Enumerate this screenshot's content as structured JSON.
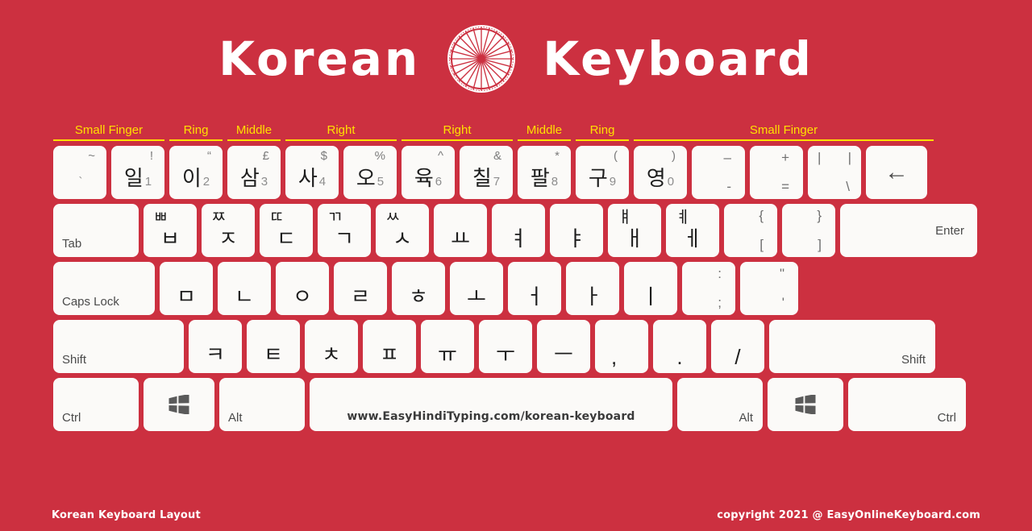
{
  "header": {
    "title_left": "Korean",
    "title_right": "Keyboard",
    "emblem_name": "korean-rosette-emblem"
  },
  "finger_guide": [
    {
      "label": "Small Finger",
      "span": 2
    },
    {
      "label": "Ring",
      "span": 1
    },
    {
      "label": "Middle",
      "span": 1
    },
    {
      "label": "Right",
      "span": 2
    },
    {
      "label": "Right",
      "span": 2
    },
    {
      "label": "Middle",
      "span": 1
    },
    {
      "label": "Ring",
      "span": 1
    },
    {
      "label": "Small Finger",
      "span": 5
    }
  ],
  "rows": {
    "number_row": [
      {
        "top": "~",
        "main": "",
        "digit": "`"
      },
      {
        "top": "!",
        "main": "일",
        "digit": "1"
      },
      {
        "top": "“",
        "main": "이",
        "digit": "2"
      },
      {
        "top": "£",
        "main": "삼",
        "digit": "3"
      },
      {
        "top": "$",
        "main": "사",
        "digit": "4"
      },
      {
        "top": "%",
        "main": "오",
        "digit": "5"
      },
      {
        "top": "^",
        "main": "육",
        "digit": "6"
      },
      {
        "top": "&",
        "main": "칠",
        "digit": "7"
      },
      {
        "top": "*",
        "main": "팔",
        "digit": "8"
      },
      {
        "top": "(",
        "main": "구",
        "digit": "9"
      },
      {
        "top": ")",
        "main": "영",
        "digit": "0"
      },
      {
        "top": "–",
        "bottom": "-"
      },
      {
        "top": "+",
        "bottom": "="
      },
      {
        "top": "|",
        "bottom": "\\",
        "alt": "|"
      },
      {
        "backspace": "←"
      }
    ],
    "tab_row": {
      "tab_label": "Tab",
      "keys": [
        {
          "shift": "ㅃ",
          "main": "ㅂ"
        },
        {
          "shift": "ㅉ",
          "main": "ㅈ"
        },
        {
          "shift": "ㄸ",
          "main": "ㄷ"
        },
        {
          "shift": "ㄲ",
          "main": "ㄱ"
        },
        {
          "shift": "ㅆ",
          "main": "ㅅ"
        },
        {
          "shift": "",
          "main": "ㅛ"
        },
        {
          "shift": "",
          "main": "ㅕ"
        },
        {
          "shift": "",
          "main": "ㅑ"
        },
        {
          "shift": "ㅒ",
          "main": "ㅐ"
        },
        {
          "shift": "ㅖ",
          "main": "ㅔ"
        },
        {
          "sym_top": "{",
          "sym_bottom": "["
        },
        {
          "sym_top": "}",
          "sym_bottom": "]"
        }
      ]
    },
    "home_row": {
      "caps_label": "Caps Lock",
      "enter_label": "Enter",
      "keys": [
        {
          "main": "ㅁ"
        },
        {
          "main": "ㄴ"
        },
        {
          "main": "ㅇ"
        },
        {
          "main": "ㄹ"
        },
        {
          "main": "ㅎ"
        },
        {
          "main": "ㅗ"
        },
        {
          "main": "ㅓ"
        },
        {
          "main": "ㅏ"
        },
        {
          "main": "ㅣ"
        },
        {
          "sym_top": ":",
          "sym_bottom": ";"
        },
        {
          "sym_top": "\"",
          "sym_bottom": "'"
        }
      ]
    },
    "shift_row": {
      "shift_left_label": "Shift",
      "shift_right_label": "Shift",
      "keys": [
        {
          "main": "ㅋ"
        },
        {
          "main": "ㅌ"
        },
        {
          "main": "ㅊ"
        },
        {
          "main": "ㅍ"
        },
        {
          "main": "ㅠ"
        },
        {
          "main": "ㅜ"
        },
        {
          "main": "ㅡ"
        },
        {
          "punct": ","
        },
        {
          "punct": "."
        },
        {
          "punct": "/"
        }
      ]
    },
    "bottom_row": {
      "ctrl_left": "Ctrl",
      "win_left": "windows-icon",
      "alt_left": "Alt",
      "space_url": "www.EasyHindiTyping.com/korean-keyboard",
      "alt_right": "Alt",
      "win_right": "windows-icon",
      "ctrl_right": "Ctrl"
    }
  },
  "footer": {
    "left": "Korean Keyboard Layout",
    "right": "copyright 2021 @ EasyOnlineKeyboard.com"
  },
  "colors": {
    "background": "#cc3040",
    "key": "#fbfaf8",
    "finger_label": "#ffe000",
    "text": "#1d1d1d"
  }
}
